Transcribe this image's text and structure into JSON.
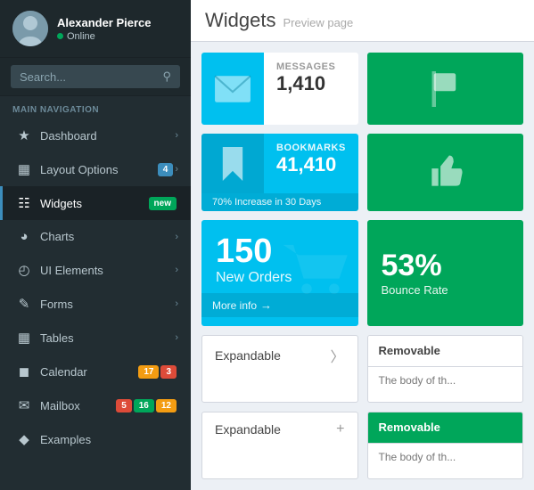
{
  "sidebar": {
    "user": {
      "name": "Alexander Pierce",
      "status": "Online"
    },
    "search": {
      "placeholder": "Search..."
    },
    "nav_label": "MAIN NAVIGATION",
    "items": [
      {
        "id": "dashboard",
        "label": "Dashboard",
        "icon": "dashboard",
        "badge": null,
        "arrow": true
      },
      {
        "id": "layout-options",
        "label": "Layout Options",
        "icon": "layout",
        "badge": "4",
        "badge_color": "blue",
        "arrow": true
      },
      {
        "id": "widgets",
        "label": "Widgets",
        "icon": "widgets",
        "badge": "new",
        "badge_color": "green",
        "arrow": false,
        "active": true
      },
      {
        "id": "charts",
        "label": "Charts",
        "icon": "charts",
        "badge": null,
        "arrow": true
      },
      {
        "id": "ui-elements",
        "label": "UI Elements",
        "icon": "ui",
        "badge": null,
        "arrow": true
      },
      {
        "id": "forms",
        "label": "Forms",
        "icon": "forms",
        "badge": null,
        "arrow": true
      },
      {
        "id": "tables",
        "label": "Tables",
        "icon": "tables",
        "badge": null,
        "arrow": true
      },
      {
        "id": "calendar",
        "label": "Calendar",
        "icon": "calendar",
        "badge1": "17",
        "badge1_color": "yellow",
        "badge2": "3",
        "badge2_color": "red"
      },
      {
        "id": "mailbox",
        "label": "Mailbox",
        "icon": "mailbox",
        "badge1": "5",
        "badge1_color": "red",
        "badge2": "16",
        "badge2_color": "green",
        "badge3": "12",
        "badge3_color": "yellow"
      },
      {
        "id": "examples",
        "label": "Examples",
        "icon": "examples",
        "badge": null
      }
    ]
  },
  "main": {
    "title": "Widgets",
    "subtitle": "Preview page",
    "widgets": {
      "messages": {
        "label": "MESSAGES",
        "value": "1,410"
      },
      "bookmarks": {
        "label": "BOOKMARKS",
        "value": "41,410",
        "footer": "70% Increase in 30 Days"
      },
      "orders": {
        "value": "150",
        "label": "New Orders",
        "footer": "More info"
      },
      "bounce": {
        "value": "53%",
        "label": "Bounce Rate"
      }
    },
    "expandable1": {
      "title": "Expandable"
    },
    "expandable2": {
      "title": "Expandable",
      "icon": "+"
    },
    "removable1": {
      "title": "Removable",
      "body": "The body of th..."
    },
    "removable2": {
      "title": "Removable",
      "body": "The body of th..."
    }
  }
}
